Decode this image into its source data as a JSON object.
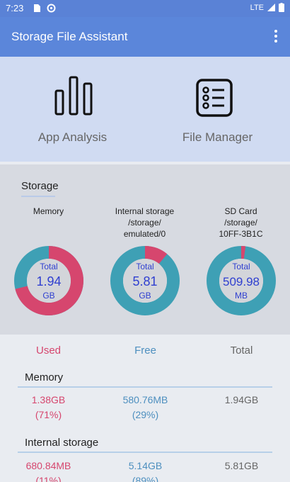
{
  "status": {
    "time": "7:23",
    "network": "LTE"
  },
  "appbar": {
    "title": "Storage File Assistant"
  },
  "launcher": [
    {
      "label": "App Analysis",
      "icon": "bar-chart-icon"
    },
    {
      "label": "File Manager",
      "icon": "file-list-icon"
    }
  ],
  "storage": {
    "title": "Storage",
    "gauges": [
      {
        "name_lines": [
          "Memory",
          "",
          ""
        ],
        "total_label": "Total",
        "value": "1.94",
        "unit": "GB",
        "used_fraction": 0.71
      },
      {
        "name_lines": [
          "Internal storage",
          "/storage/",
          "emulated/0"
        ],
        "total_label": "Total",
        "value": "5.81",
        "unit": "GB",
        "used_fraction": 0.11
      },
      {
        "name_lines": [
          "SD Card",
          "/storage/",
          "10FF-3B1C"
        ],
        "total_label": "Total",
        "value": "509.98",
        "unit": "MB",
        "used_fraction": 0.02
      }
    ]
  },
  "table": {
    "headers": {
      "used": "Used",
      "free": "Free",
      "total": "Total"
    },
    "sections": [
      {
        "title": "Memory",
        "used": "1.38GB",
        "used_pct": "(71%)",
        "free": "580.76MB",
        "free_pct": "(29%)",
        "total": "1.94GB"
      },
      {
        "title": "Internal storage",
        "used": "680.84MB",
        "used_pct": "(11%)",
        "free": "5.14GB",
        "free_pct": "(89%)",
        "total": "5.81GB"
      }
    ]
  },
  "colors": {
    "used": "#d6466e",
    "free": "#3ea0b5",
    "accent": "#5b86da"
  }
}
